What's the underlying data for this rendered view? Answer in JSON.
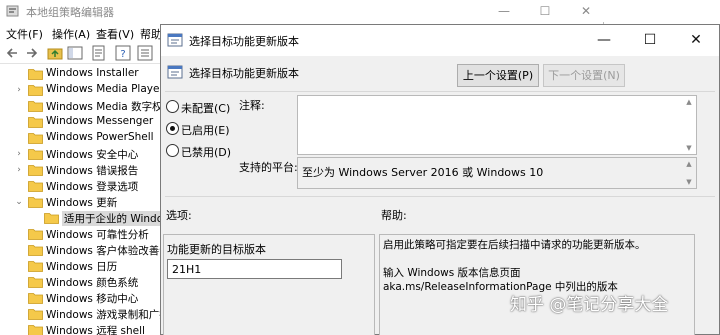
{
  "bg_window": {
    "title": "本地组策略编辑器",
    "minimize_icon": "—",
    "maximize_icon": "☐",
    "close_icon": "✕",
    "menu": [
      "文件(F)",
      "操作(A)",
      "查看(V)",
      "帮助"
    ],
    "tree": [
      {
        "label": "Windows Installer",
        "expand": ""
      },
      {
        "label": "Windows Media Player",
        "expand": ">"
      },
      {
        "label": "Windows Media 数字权限",
        "expand": ""
      },
      {
        "label": "Windows Messenger",
        "expand": ""
      },
      {
        "label": "Windows PowerShell",
        "expand": ""
      },
      {
        "label": "Windows 安全中心",
        "expand": ">"
      },
      {
        "label": "Windows 错误报告",
        "expand": ">"
      },
      {
        "label": "Windows 登录选项",
        "expand": ""
      },
      {
        "label": "Windows 更新",
        "expand": "v"
      },
      {
        "label": "适用于企业的 Windows",
        "expand": "",
        "selected": true,
        "indent": true
      },
      {
        "label": "Windows 可靠性分析",
        "expand": ""
      },
      {
        "label": "Windows 客户体验改善计",
        "expand": ""
      },
      {
        "label": "Windows 日历",
        "expand": ""
      },
      {
        "label": "Windows 颜色系统",
        "expand": ""
      },
      {
        "label": "Windows 移动中心",
        "expand": ""
      },
      {
        "label": "Windows 游戏录制和广播",
        "expand": ""
      },
      {
        "label": "Windows 远程 shell",
        "expand": ""
      }
    ]
  },
  "dialog": {
    "title": "选择目标功能更新版本",
    "minimize_icon": "—",
    "maximize_icon": "☐",
    "close_icon": "✕",
    "heading": "选择目标功能更新版本",
    "prev_button": "上一个设置(P)",
    "next_button": "下一个设置(N)",
    "radios": [
      {
        "label": "未配置(C)",
        "checked": false
      },
      {
        "label": "已启用(E)",
        "checked": true
      },
      {
        "label": "已禁用(D)",
        "checked": false
      }
    ],
    "comment_label": "注释:",
    "supported_label": "支持的平台:",
    "supported_value": "至少为 Windows Server 2016 或 Windows 10",
    "options_label": "选项:",
    "help_label": "帮助:",
    "target_label": "功能更新的目标版本",
    "target_value": "21H1",
    "help_line1": "启用此策略可指定要在后续扫描中请求的功能更新版本。",
    "help_line2": "输入 Windows 版本信息页面 aka.ms/ReleaseInformationPage 中列出的版本"
  },
  "watermark": "知乎 @笔记分享大全"
}
